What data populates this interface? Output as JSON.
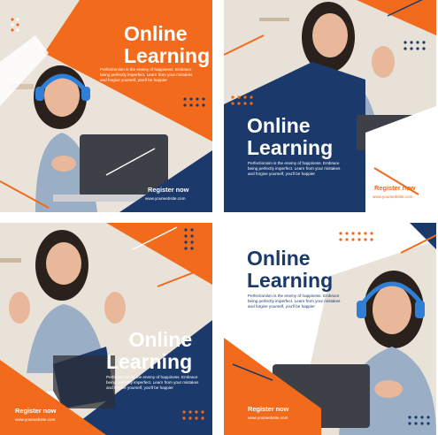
{
  "colors": {
    "orange": "#f26b1d",
    "navy": "#1b3a6b",
    "white": "#ffffff"
  },
  "posts": [
    {
      "title_line1": "Online",
      "title_line2": "Learning",
      "body": "Perfectionism is the enemy of happiness. Embrace being perfectly imperfect. Learn from your mistakes and forgive yourself, you'll be happier",
      "cta": "Register now",
      "website": "www.yourwebsite.com"
    },
    {
      "title_line1": "Online",
      "title_line2": "Learning",
      "body": "Perfectionism is the enemy of happiness. Embrace being perfectly imperfect. Learn from your mistakes and forgive yourself, you'll be happier",
      "cta": "Register now",
      "website": "www.yourwebsite.com"
    },
    {
      "title_line1": "Online",
      "title_line2": "Learning",
      "body": "Perfectionism is the enemy of happiness. Embrace being perfectly imperfect. Learn from your mistakes and forgive yourself, you'll be happier",
      "cta": "Register now",
      "website": "www.yourwebsite.com"
    },
    {
      "title_line1": "Online",
      "title_line2": "Learning",
      "body": "Perfectionism is the enemy of happiness. Embrace being perfectly imperfect. Learn from your mistakes and forgive yourself, you'll be happier",
      "cta": "Register now",
      "website": "www.yourwebsite.com"
    }
  ]
}
